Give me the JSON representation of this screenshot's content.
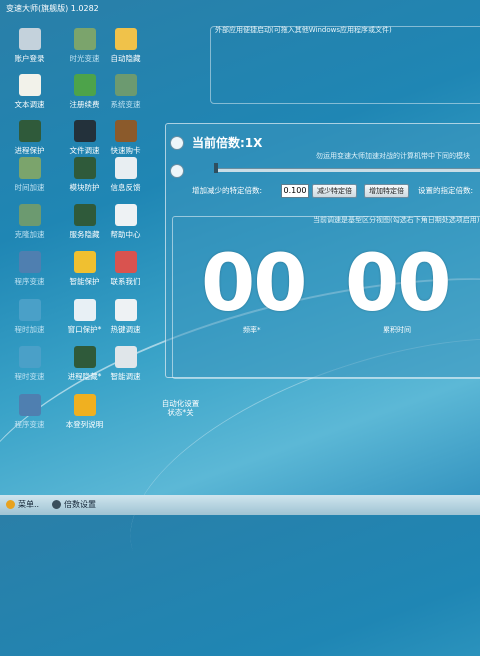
{
  "window": {
    "title": "变速大师(旗舰版) 1.0282"
  },
  "tiles": [
    {
      "label": "账户登录",
      "icon": "link-icon",
      "color": "#c4d2dc",
      "dim": false
    },
    {
      "label": "时光变速",
      "icon": "chip-icon",
      "color": "#7ba46c",
      "dim": true
    },
    {
      "label": "自动隐藏",
      "icon": "folder-icon",
      "color": "#f0c24a",
      "dim": false
    },
    {
      "label": "文本调速",
      "icon": "edit-icon",
      "color": "#f2f2ea",
      "dim": false
    },
    {
      "label": "注册续费",
      "icon": "contacts-icon",
      "color": "#4da34a",
      "dim": false
    },
    {
      "label": "系统变速",
      "icon": "chip-icon",
      "color": "#6c9a70",
      "dim": true
    },
    {
      "label": "进程保护",
      "icon": "monitor-chart-icon",
      "color": "#2f5a3a",
      "dim": false
    },
    {
      "label": "文件调速",
      "icon": "terminal-icon",
      "color": "#23313b",
      "dim": false
    },
    {
      "label": "快速购卡",
      "icon": "wallet-icon",
      "color": "#8b5a2b",
      "dim": false
    },
    {
      "label": "时间加速",
      "icon": "chip-icon",
      "color": "#7ba46c",
      "dim": true
    },
    {
      "label": "模块防护",
      "icon": "monitor-chart-icon",
      "color": "#2f5a3a",
      "dim": false
    },
    {
      "label": "信息反馈",
      "icon": "mail-icon",
      "color": "#e8eef2",
      "dim": false
    },
    {
      "label": "克隆加速",
      "icon": "chip-icon",
      "color": "#6c9a70",
      "dim": true
    },
    {
      "label": "服务隐藏",
      "icon": "monitor-chart-icon",
      "color": "#2f5a3a",
      "dim": false
    },
    {
      "label": "帮助中心",
      "icon": "document-icon",
      "color": "#eef2f4",
      "dim": false
    },
    {
      "label": "程序变速",
      "icon": "grid-icon",
      "color": "#4f7fb0",
      "dim": true
    },
    {
      "label": "智能保护",
      "icon": "shield-icon",
      "color": "#f0c030",
      "dim": false
    },
    {
      "label": "联系我们",
      "icon": "presentation-icon",
      "color": "#d9534f",
      "dim": false
    },
    {
      "label": "程时加速",
      "icon": "clock-icon",
      "color": "#4aa0c8",
      "dim": true
    },
    {
      "label": "窗口保护*",
      "icon": "window-icon",
      "color": "#e8f0f5",
      "dim": false
    },
    {
      "label": "热键调速",
      "icon": "bar-chart-icon",
      "color": "#eef2f4",
      "dim": false
    },
    {
      "label": "程时变速",
      "icon": "clock-icon",
      "color": "#4aa0c8",
      "dim": true
    },
    {
      "label": "进程隐藏*",
      "icon": "monitor-chart-icon",
      "color": "#2f5a3a",
      "dim": false
    },
    {
      "label": "智能调速",
      "icon": "gauge-icon",
      "color": "#e0e6ea",
      "dim": false
    },
    {
      "label": "程序变速",
      "icon": "grid-icon",
      "color": "#4f7fb0",
      "dim": true
    },
    {
      "label": "本登列说明",
      "icon": "compass-icon",
      "color": "#f0b020",
      "dim": false
    },
    {
      "label": "自动化设置状态*关",
      "icon": "none",
      "color": "",
      "dim": false
    }
  ],
  "top_panel": {
    "caption": "外部应用便捷启动(可拖入其他Windows应用程序或文件)"
  },
  "overlay": {
    "title": "当前倍数:1X",
    "hint": "勿运用变速大师加速对战的计算机带中下同的模块",
    "multiplier_label": "增加减少的特定倍数:",
    "multiplier_value": "0.100",
    "decrease_btn": "减少特定倍",
    "increase_btn": "增加特定倍",
    "preset_label": "设置的指定倍数:",
    "view_caption": "当前调速是基型区分视图(勾选右下角日期处选项启用)",
    "left_digits": "00",
    "right_digits": "00",
    "left_label": "频率*",
    "right_label": "累积时间"
  },
  "taskbar": {
    "menu": "菜单..",
    "speed_settings": "倍数设置"
  }
}
